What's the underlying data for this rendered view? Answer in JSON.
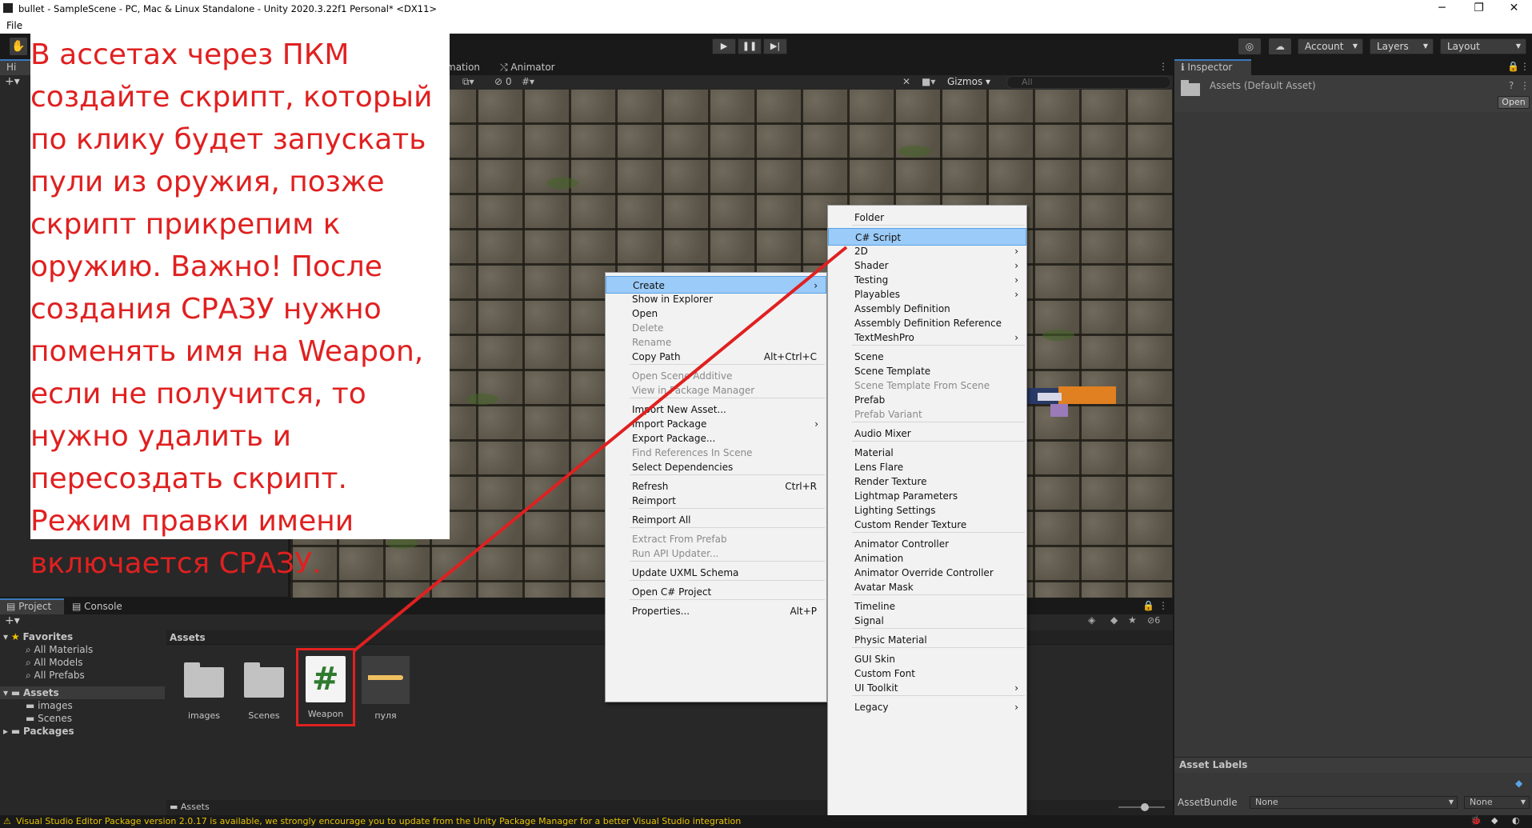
{
  "window": {
    "title": "bullet - SampleScene - PC, Mac & Linux Standalone - Unity 2020.3.22f1 Personal* <DX11>",
    "minimize": "─",
    "restore": "❐",
    "close": "✕"
  },
  "menubar": {
    "file": "File"
  },
  "toolbar": {
    "account": "Account",
    "layers": "Layers",
    "layout": "Layout"
  },
  "scene": {
    "tab_animation_partial": "mation",
    "tab_animator": "Animator",
    "gizmos": "Gizmos",
    "search_placeholder": "All",
    "hierarchy_partial": "Hi",
    "visibility_count": "0"
  },
  "annotation": {
    "text": "В ассетах через ПКМ создайте скрипт, который по клику будет запускать пули из оружия, позже скрипт прикрепим к оружию. Важно! После создания СРАЗУ нужно поменять имя на Weapon, если не получится, то нужно удалить и пересоздать скрипт. Режим правки имени включается СРАЗУ."
  },
  "project": {
    "tab_project": "Project",
    "tab_console": "Console",
    "favorites": "Favorites",
    "fav_items": [
      "All Materials",
      "All Models",
      "All Prefabs"
    ],
    "assets_root": "Assets",
    "asset_folders": [
      "images",
      "Scenes"
    ],
    "packages": "Packages",
    "breadcrumb": "Assets",
    "footer_path": "Assets",
    "hidden_count": "6",
    "tiles": [
      {
        "label": "images"
      },
      {
        "label": "Scenes"
      },
      {
        "label": "Weapon"
      },
      {
        "label": "пуля"
      }
    ],
    "script_glyph": "#"
  },
  "context_menu": {
    "items": [
      {
        "label": "Create",
        "shortcut": "",
        "submenu": true,
        "state": "highlighted"
      },
      {
        "label": "Show in Explorer",
        "shortcut": "",
        "submenu": false,
        "state": "enabled"
      },
      {
        "label": "Open",
        "shortcut": "",
        "submenu": false,
        "state": "enabled"
      },
      {
        "label": "Delete",
        "shortcut": "",
        "submenu": false,
        "state": "disabled"
      },
      {
        "label": "Rename",
        "shortcut": "",
        "submenu": false,
        "state": "disabled"
      },
      {
        "label": "Copy Path",
        "shortcut": "Alt+Ctrl+C",
        "submenu": false,
        "state": "enabled"
      },
      {
        "label": "Open Scene Additive",
        "shortcut": "",
        "submenu": false,
        "state": "disabled"
      },
      {
        "label": "View in Package Manager",
        "shortcut": "",
        "submenu": false,
        "state": "disabled"
      },
      {
        "label": "Import New Asset...",
        "shortcut": "",
        "submenu": false,
        "state": "enabled"
      },
      {
        "label": "Import Package",
        "shortcut": "",
        "submenu": true,
        "state": "enabled"
      },
      {
        "label": "Export Package...",
        "shortcut": "",
        "submenu": false,
        "state": "enabled"
      },
      {
        "label": "Find References In Scene",
        "shortcut": "",
        "submenu": false,
        "state": "disabled"
      },
      {
        "label": "Select Dependencies",
        "shortcut": "",
        "submenu": false,
        "state": "enabled"
      },
      {
        "label": "Refresh",
        "shortcut": "Ctrl+R",
        "submenu": false,
        "state": "enabled"
      },
      {
        "label": "Reimport",
        "shortcut": "",
        "submenu": false,
        "state": "enabled"
      },
      {
        "label": "Reimport All",
        "shortcut": "",
        "submenu": false,
        "state": "enabled"
      },
      {
        "label": "Extract From Prefab",
        "shortcut": "",
        "submenu": false,
        "state": "disabled"
      },
      {
        "label": "Run API Updater...",
        "shortcut": "",
        "submenu": false,
        "state": "disabled"
      },
      {
        "label": "Update UXML Schema",
        "shortcut": "",
        "submenu": false,
        "state": "enabled"
      },
      {
        "label": "Open C# Project",
        "shortcut": "",
        "submenu": false,
        "state": "enabled"
      },
      {
        "label": "Properties...",
        "shortcut": "Alt+P",
        "submenu": false,
        "state": "enabled"
      }
    ]
  },
  "create_menu": {
    "items": [
      {
        "label": "Folder",
        "submenu": false,
        "state": "enabled"
      },
      {
        "label": "C# Script",
        "submenu": false,
        "state": "highlighted"
      },
      {
        "label": "2D",
        "submenu": true,
        "state": "enabled"
      },
      {
        "label": "Shader",
        "submenu": true,
        "state": "enabled"
      },
      {
        "label": "Testing",
        "submenu": true,
        "state": "enabled"
      },
      {
        "label": "Playables",
        "submenu": true,
        "state": "enabled"
      },
      {
        "label": "Assembly Definition",
        "submenu": false,
        "state": "enabled"
      },
      {
        "label": "Assembly Definition Reference",
        "submenu": false,
        "state": "enabled"
      },
      {
        "label": "TextMeshPro",
        "submenu": true,
        "state": "enabled"
      },
      {
        "label": "Scene",
        "submenu": false,
        "state": "enabled"
      },
      {
        "label": "Scene Template",
        "submenu": false,
        "state": "enabled"
      },
      {
        "label": "Scene Template From Scene",
        "submenu": false,
        "state": "disabled"
      },
      {
        "label": "Prefab",
        "submenu": false,
        "state": "enabled"
      },
      {
        "label": "Prefab Variant",
        "submenu": false,
        "state": "disabled"
      },
      {
        "label": "Audio Mixer",
        "submenu": false,
        "state": "enabled"
      },
      {
        "label": "Material",
        "submenu": false,
        "state": "enabled"
      },
      {
        "label": "Lens Flare",
        "submenu": false,
        "state": "enabled"
      },
      {
        "label": "Render Texture",
        "submenu": false,
        "state": "enabled"
      },
      {
        "label": "Lightmap Parameters",
        "submenu": false,
        "state": "enabled"
      },
      {
        "label": "Lighting Settings",
        "submenu": false,
        "state": "enabled"
      },
      {
        "label": "Custom Render Texture",
        "submenu": false,
        "state": "enabled"
      },
      {
        "label": "Animator Controller",
        "submenu": false,
        "state": "enabled"
      },
      {
        "label": "Animation",
        "submenu": false,
        "state": "enabled"
      },
      {
        "label": "Animator Override Controller",
        "submenu": false,
        "state": "enabled"
      },
      {
        "label": "Avatar Mask",
        "submenu": false,
        "state": "enabled"
      },
      {
        "label": "Timeline",
        "submenu": false,
        "state": "enabled"
      },
      {
        "label": "Signal",
        "submenu": false,
        "state": "enabled"
      },
      {
        "label": "Physic Material",
        "submenu": false,
        "state": "enabled"
      },
      {
        "label": "GUI Skin",
        "submenu": false,
        "state": "enabled"
      },
      {
        "label": "Custom Font",
        "submenu": false,
        "state": "enabled"
      },
      {
        "label": "UI Toolkit",
        "submenu": true,
        "state": "enabled"
      },
      {
        "label": "Legacy",
        "submenu": true,
        "state": "enabled"
      }
    ]
  },
  "inspector": {
    "tab": "Inspector",
    "asset_title": "Assets (Default Asset)",
    "open_button": "Open",
    "asset_labels": "Asset Labels",
    "asset_bundle_label": "AssetBundle",
    "bundle_value": "None",
    "variant_value": "None"
  },
  "status": {
    "message": "Visual Studio Editor Package version 2.0.17 is available, we strongly encourage you to update from the Unity Package Manager for a better Visual Studio integration"
  },
  "colors": {
    "annotation_text": "#e02020",
    "highlight": "#9bcbf8",
    "arrow": "#e02020",
    "status_warning": "#e8c400"
  }
}
